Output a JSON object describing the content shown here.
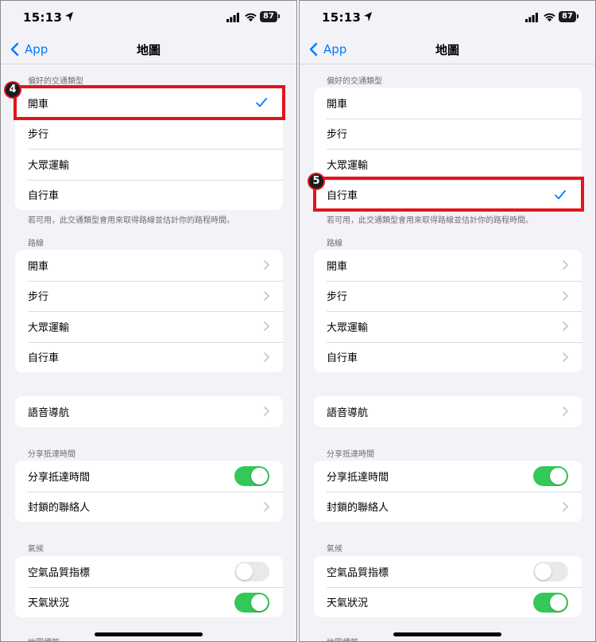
{
  "status": {
    "time": "15:13",
    "battery": "87"
  },
  "nav": {
    "back_label": "App",
    "title": "地圖"
  },
  "sections": {
    "transport_header": "偏好的交通類型",
    "transport_items": [
      "開車",
      "步行",
      "大眾運輸",
      "自行車"
    ],
    "transport_footer": "若可用，此交通類型會用來取得路線並估計你的路程時間。",
    "routes_header": "路線",
    "route_items": [
      "開車",
      "步行",
      "大眾運輸",
      "自行車"
    ],
    "voice_nav": "語音導航",
    "share_header": "分享抵達時間",
    "share_items": [
      "分享抵達時間",
      "封鎖的聯絡人"
    ],
    "weather_header": "氣候",
    "weather_items": [
      "空氣品質指標",
      "天氣狀況"
    ],
    "cutoff_header": "地圖標籤"
  },
  "left_panel": {
    "step": "4",
    "selected_transport": "開車",
    "share_eta_on": true,
    "aqi_on": false,
    "weather_on": true
  },
  "right_panel": {
    "step": "5",
    "selected_transport": "自行車",
    "share_eta_on": true,
    "aqi_on": false,
    "weather_on": true
  },
  "colors": {
    "accent": "#007aff",
    "toggle_on": "#34c759",
    "highlight": "#e3141b"
  }
}
